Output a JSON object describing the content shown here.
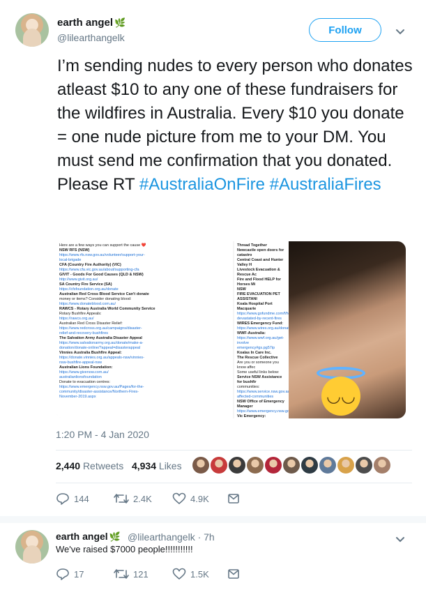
{
  "tweet": {
    "display_name": "earth angel",
    "handle": "@lilearthangelk",
    "follow_label": "Follow",
    "text_plain": "I’m sending nudes to every person who donates atleast $10 to any one of these fundraisers for the wildfires in Australia. Every $10 you donate = one nude picture from me to your DM. You must send me confirmation that you donated. Please RT",
    "hashtag1": "#AustraliaOnFire",
    "hashtag2": "#AustraliaFires",
    "timestamp": "1:20 PM - 4 Jan 2020",
    "retweets_count": "2,440",
    "retweets_label": "Retweets",
    "likes_count": "4,934",
    "likes_label": "Likes",
    "actions": {
      "replies": "144",
      "retweets": "2.4K",
      "likes": "4.9K"
    }
  },
  "media": {
    "col1": [
      {
        "t": "Here are a few ways you can support the cause ❤️"
      },
      {
        "t": "NSW RFS (NSW)",
        "b": true
      },
      {
        "t": "https://www.rfs.nsw.gov.au/volunteer/support-your-",
        "l": true
      },
      {
        "t": "local-brigade",
        "l": true
      },
      {
        "t": "CFA (Country Fire Authority) (VIC)",
        "b": true
      },
      {
        "t": "https://www.cfa.vic.gov.au/about/supporting-cfa",
        "l": true
      },
      {
        "t": "GIVIT - Goods For Good Causes (QLD & NSW)",
        "b": true
      },
      {
        "t": "http://www.givit.org.au/",
        "l": true
      },
      {
        "t": "SA Country Fire Service (SA)",
        "b": true
      },
      {
        "t": "https://cfsfoundation.org.au/donate",
        "l": true
      },
      {
        "t": " "
      },
      {
        "t": "Australian Red Cross Blood Service Can't donate",
        "b": true
      },
      {
        "t": "money or items? Consider donating blood:"
      },
      {
        "t": "https://www.donateblood.com.au/",
        "l": true
      },
      {
        "t": "RAWCS - Rotary Australia World Community Service",
        "b": true
      },
      {
        "t": "Rotary Bushfire Appeals:"
      },
      {
        "t": "https://rawcs.org.au/",
        "l": true
      },
      {
        "t": " "
      },
      {
        "t": "Australian Red Cross Disaster Relief:"
      },
      {
        "t": "https://www.redcross.org.au/campaigns/disaster-",
        "l": true
      },
      {
        "t": "relief-and-recovery-bushfires",
        "l": true
      },
      {
        "t": "The Salvation Army Australia Disaster Appeal",
        "b": true
      },
      {
        "t": "https://www.salvationarmy.org.au/donate/make-a-",
        "l": true
      },
      {
        "t": "donation/donate-online/?appeal=disasterappeal",
        "l": true
      },
      {
        "t": "Vinnies Australia Bushfire Appeal:",
        "b": true
      },
      {
        "t": "https://donate.vinnies.org.au/appeals-nsw/vinnies-",
        "l": true
      },
      {
        "t": "nsw-bushfire-appeal-nsw",
        "l": true
      },
      {
        "t": "Australian Lions Foundation:",
        "b": true
      },
      {
        "t": "https://www.givenow.com.au/",
        "l": true
      },
      {
        "t": "australianlionsfoundation",
        "l": true
      },
      {
        "t": "Donate to evacuation centres:"
      },
      {
        "t": "https://www.emergency.nsw.gov.au/Pages/for-the-",
        "l": true
      },
      {
        "t": "community/disaster-assistance/Northern-Fires-",
        "l": true
      },
      {
        "t": "November-2019.aspx",
        "l": true
      }
    ],
    "col2": [
      {
        "t": "Thread Together",
        "b": true
      },
      {
        "t": "Newcastle open doors for catastro",
        "b": true
      },
      {
        "t": "Central Coast and Hunter Valley H",
        "b": true
      },
      {
        "t": "Livestock Evacuation & Rescue Ac",
        "b": true
      },
      {
        "t": "Fire and Flood HELP for Horses Mi",
        "b": true
      },
      {
        "t": "NSW",
        "b": true
      },
      {
        "t": "FIRE EVACUATION PET ASSISTANI",
        "b": true
      },
      {
        "t": " "
      },
      {
        "t": "Koala Hospital Port Macquarie",
        "b": true
      },
      {
        "t": "https://www.gofundme.com/f/help-",
        "l": true
      },
      {
        "t": "devastated-by-recent-fires",
        "l": true
      },
      {
        "t": "WIRES Emergency Fund:",
        "b": true
      },
      {
        "t": "https://www.wires.org.au/donate/em",
        "l": true
      },
      {
        "t": "WWF-Australia:",
        "b": true
      },
      {
        "t": "https://www.wwf.org.au/get-involve",
        "l": true
      },
      {
        "t": "emergency#gs.pg57ip",
        "l": true
      },
      {
        "t": "Koalas In Care Inc.",
        "b": true
      },
      {
        "t": "The Rescue Collective",
        "b": true
      },
      {
        "t": " "
      },
      {
        "t": "Are you or someone you know affec"
      },
      {
        "t": "Some useful links below:"
      },
      {
        "t": "Service NSW Assistance for bushfir",
        "b": true
      },
      {
        "t": "communities:"
      },
      {
        "t": "https://www.service.nsw.gov.au/ass",
        "l": true
      },
      {
        "t": "affected-communities",
        "l": true
      },
      {
        "t": "NSW Office of Emergency Manager",
        "b": true
      },
      {
        "t": "https://www.emergency.nsw.gov.au/",
        "l": true
      },
      {
        "t": "Vic Emergency:",
        "b": true
      },
      {
        "t": "http://emergency.vic.gov.au/prepare",
        "l": true
      },
      {
        "t": "warnings",
        "l": true
      },
      {
        "t": "Department of Human Services:",
        "b": true
      },
      {
        "t": "https://www.humanservices.gov.au/",
        "l": true
      },
      {
        "t": "centrelink",
        "l": true
      }
    ]
  },
  "likers": [
    "#7a5a48",
    "#c73b3b",
    "#3b3b3b",
    "#8c6b4f",
    "#b3263a",
    "#6e5a4b",
    "#2e3b44",
    "#5f7a9a",
    "#d8a24a",
    "#4d4d4d",
    "#a47f6a"
  ],
  "reply": {
    "display_name": "earth angel",
    "handle_time": "@lilearthangelk · 7h",
    "text": "We've raised $7000 people!!!!!!!!!!!",
    "actions": {
      "replies": "17",
      "retweets": "121",
      "likes": "1.5K"
    }
  }
}
